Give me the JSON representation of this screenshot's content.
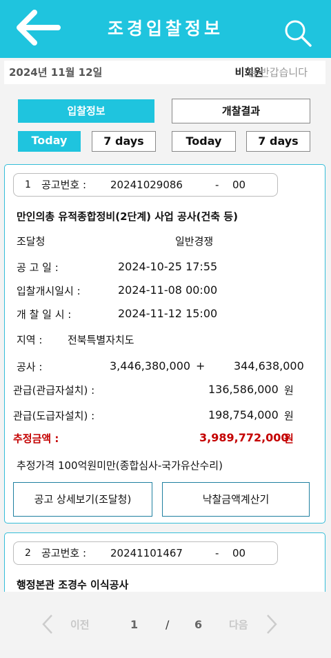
{
  "header": {
    "title": "조경입찰정보",
    "back_icon": "back-arrow-icon",
    "search_icon": "search-icon"
  },
  "info": {
    "date": "2024년 11월 12일",
    "user": "비회원",
    "greeting": "님 반갑습니다"
  },
  "tabs": [
    {
      "label": "입찰정보",
      "active": true
    },
    {
      "label": "개찰결과",
      "active": false
    }
  ],
  "filters": [
    {
      "label": "Today",
      "active": true
    },
    {
      "label": "7 days",
      "active": false
    },
    {
      "label": "Today",
      "active": false
    },
    {
      "label": "7 days",
      "active": false
    }
  ],
  "cards": [
    {
      "index": "1",
      "notice_label": "공고번호 :",
      "notice_no": "20241029086",
      "dash": "-",
      "notice_seq": "00",
      "title": "만인의총 유적종합정비(2단계) 사업 공사(건축 등)",
      "agency": "조달청",
      "contract_type": "일반경쟁",
      "notice_date_label": "공 고 일 :",
      "notice_date": "2024-10-25 17:55",
      "bid_start_label": "입찰개시일시 :",
      "bid_start": "2024-11-08 00:00",
      "opening_label": "개 찰 일 시 :",
      "opening": "2024-11-12 15:00",
      "region_label": "지역 :",
      "region": "전북특별자치도",
      "construction_label": "공사 :",
      "construction_amount": "3,446,380,000",
      "plus": "+",
      "construction_vat": "344,638,000",
      "supply_owner_label": "관급(관급자설치) :",
      "supply_owner": "136,586,000",
      "supply_contractor_label": "관급(도급자설치) :",
      "supply_contractor": "198,754,000",
      "won": "원",
      "estimate_label": "추정금액 :",
      "estimate": "3,989,772,000",
      "note": "추정가격 100억원미만(종합심사-국가유산수리)",
      "btn_detail": "공고 상세보기(조달청)",
      "btn_calc": "낙찰금액계산기"
    },
    {
      "index": "2",
      "notice_label": "공고번호 :",
      "notice_no": "20241101467",
      "dash": "-",
      "notice_seq": "00",
      "title": "행정본관 조경수 이식공사"
    }
  ],
  "pager": {
    "prev": "이전",
    "current": "1",
    "separator": "/",
    "total": "6",
    "next": "다음"
  },
  "colors": {
    "accent": "#1fc4de",
    "estimate": "#c40000"
  }
}
